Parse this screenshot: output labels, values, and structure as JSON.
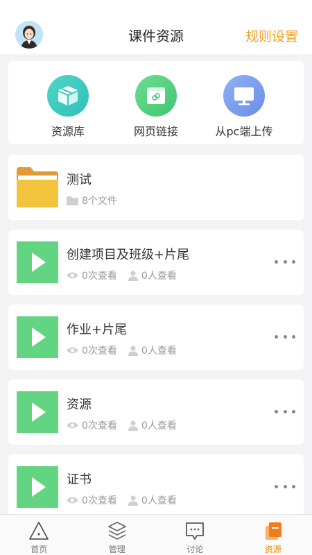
{
  "header": {
    "title": "课件资源",
    "rule_link": "规则设置"
  },
  "upload_options": [
    {
      "label": "资源库",
      "icon": "cube-box-icon"
    },
    {
      "label": "网页链接",
      "icon": "web-link-icon"
    },
    {
      "label": "从pc端上传",
      "icon": "computer-monitor-icon"
    }
  ],
  "folder": {
    "title": "测试",
    "file_count": "8个文件"
  },
  "resources": [
    {
      "title": "创建项目及班级+片尾",
      "views": "0次查看",
      "viewers": "0人查看"
    },
    {
      "title": "作业+片尾",
      "views": "0次查看",
      "viewers": "0人查看"
    },
    {
      "title": "资源",
      "views": "0次查看",
      "viewers": "0人查看"
    },
    {
      "title": "证书",
      "views": "0次查看",
      "viewers": "0人查看"
    }
  ],
  "tabs": [
    {
      "label": "首页",
      "icon": "home-triangle-icon"
    },
    {
      "label": "管理",
      "icon": "layers-icon"
    },
    {
      "label": "讨论",
      "icon": "chat-book-icon"
    },
    {
      "label": "资源",
      "icon": "resource-stack-icon",
      "active": true
    }
  ],
  "colors": {
    "accent": "#f0a020",
    "video_thumb": "#63d482",
    "folder": "#f2c43e",
    "tab_active": "#f08a00"
  }
}
